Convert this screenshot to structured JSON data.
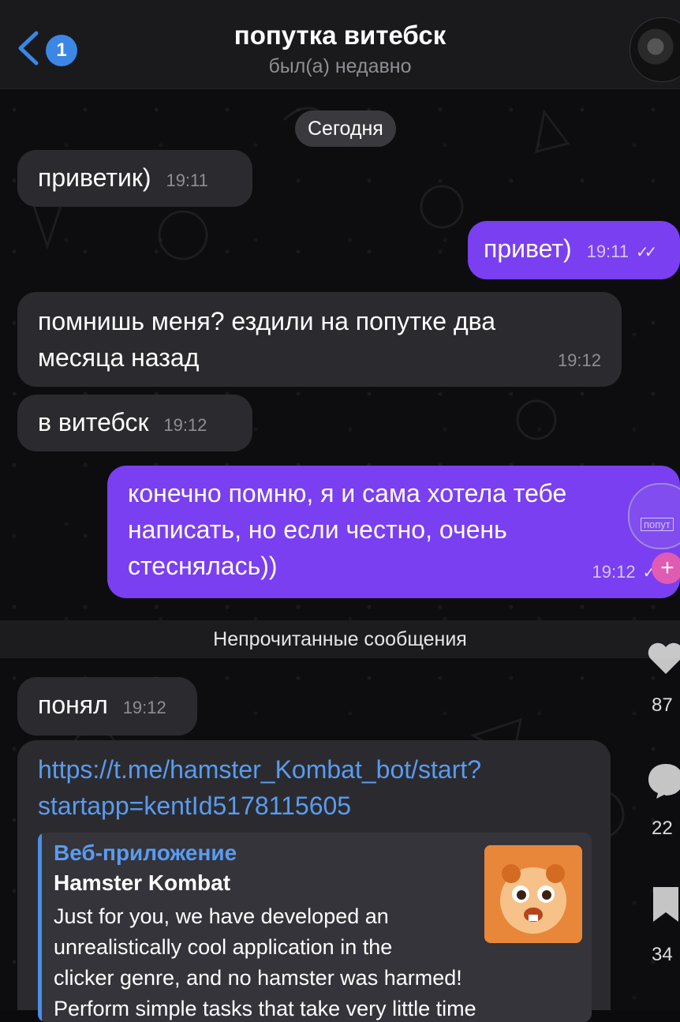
{
  "header": {
    "back_badge": "1",
    "title": "попутка витебск",
    "status": "был(а) недавно"
  },
  "date_separator": "Сегодня",
  "messages": [
    {
      "dir": "in",
      "text": "приветик)",
      "time": "19:11"
    },
    {
      "dir": "out",
      "text": "привет)",
      "time": "19:11"
    },
    {
      "dir": "in",
      "lines": [
        "помнишь меня? ездили на попутке два",
        "месяца назад"
      ],
      "time": "19:12"
    },
    {
      "dir": "in",
      "text": "в витебск",
      "time": "19:12"
    },
    {
      "dir": "out",
      "lines": [
        "конечно помню, я и сама хотела тебе",
        "написать, но если честно, очень",
        "стеснялась))"
      ],
      "time": "19:12"
    }
  ],
  "unread_separator": "Непрочитанные сообщения",
  "unread_messages": [
    {
      "dir": "in",
      "text": "понял",
      "time": "19:12"
    }
  ],
  "link_message": {
    "url_lines": [
      "https://t.me/hamster_Kombat_bot/start?",
      "startapp=kentId5178115605"
    ],
    "preview": {
      "site": "Веб-приложение",
      "title": "Hamster Kombat",
      "description_lines": [
        "Just for you, we have developed an",
        "unrealistically cool application in the",
        "clicker genre, and no hamster was harmed!",
        "Perform simple tasks that take very little time"
      ]
    }
  },
  "overlay": {
    "like_count": "87",
    "comment_count": "22",
    "save_count": "34",
    "floating_label": "попут"
  },
  "colors": {
    "outgoing_bubble": "#7a3ff0",
    "incoming_bubble": "#2b2b2f",
    "link": "#5a9bf0",
    "badge": "#3c86e6"
  }
}
